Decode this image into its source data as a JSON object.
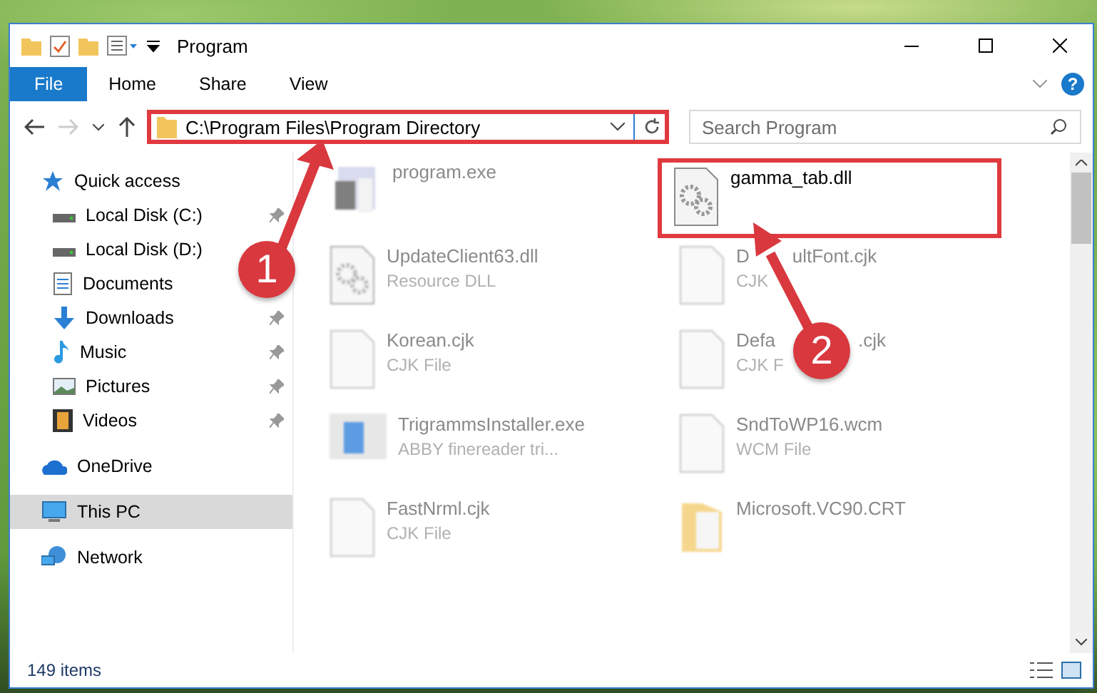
{
  "window": {
    "title": "Program"
  },
  "ribbon": {
    "tabs": [
      {
        "label": "File",
        "kind": "file"
      },
      {
        "label": "Home",
        "kind": "tab"
      },
      {
        "label": "Share",
        "kind": "tab"
      },
      {
        "label": "View",
        "kind": "tab"
      }
    ],
    "help": "?"
  },
  "address": {
    "path": "C:\\Program Files\\Program Directory",
    "highlighted": true
  },
  "search": {
    "placeholder": "Search Program"
  },
  "sidebar": {
    "items": [
      {
        "label": "Quick access",
        "kind": "star",
        "selected": false,
        "children": [
          {
            "label": "Local Disk (C:)",
            "kind": "drive",
            "pinned": true
          },
          {
            "label": "Local Disk (D:)",
            "kind": "drive",
            "pinned": false
          },
          {
            "label": "Documents",
            "kind": "documents",
            "pinned": false
          },
          {
            "label": "Downloads",
            "kind": "downloads",
            "pinned": true
          },
          {
            "label": "Music",
            "kind": "music",
            "pinned": true
          },
          {
            "label": "Pictures",
            "kind": "pictures",
            "pinned": true
          },
          {
            "label": "Videos",
            "kind": "videos",
            "pinned": true
          }
        ]
      },
      {
        "label": "OneDrive",
        "kind": "cloud",
        "selected": false
      },
      {
        "label": "This PC",
        "kind": "pc",
        "selected": true
      },
      {
        "label": "Network",
        "kind": "network",
        "selected": false
      }
    ]
  },
  "files": [
    {
      "name": "program.exe",
      "kind": "exe",
      "blurred": true,
      "highlighted": false
    },
    {
      "name": "gamma_tab.dll",
      "kind": "dll",
      "blurred": false,
      "highlighted": true
    },
    {
      "name": "UpdateClient63.dll",
      "type": "Resource DLL",
      "kind": "dll",
      "blurred": true,
      "highlighted": false
    },
    {
      "name": [
        "D",
        "ultFont.cjk"
      ],
      "type": [
        "CJK"
      ],
      "kind": "file",
      "blurred": true,
      "highlighted": false
    },
    {
      "name": "Korean.cjk",
      "type": "CJK File",
      "kind": "file",
      "blurred": true,
      "highlighted": false
    },
    {
      "name": [
        "Defa",
        ".cjk"
      ],
      "type": [
        "CJK F"
      ],
      "kind": "file",
      "blurred": true,
      "highlighted": false
    },
    {
      "name": "TrigrammsInstaller.exe",
      "type": "ABBY finereader tri...",
      "kind": "installer",
      "blurred": true,
      "highlighted": false
    },
    {
      "name": "SndToWP16.wcm",
      "type": "WCM File",
      "kind": "file",
      "blurred": true,
      "highlighted": false
    },
    {
      "name": "FastNrml.cjk",
      "type": "CJK File",
      "kind": "file",
      "blurred": true,
      "highlighted": false
    },
    {
      "name": "Microsoft.VC90.CRT",
      "kind": "folder",
      "blurred": true,
      "highlighted": false
    }
  ],
  "annotations": [
    {
      "label": "1"
    },
    {
      "label": "2"
    }
  ],
  "status_bar": {
    "count": "149 items"
  }
}
